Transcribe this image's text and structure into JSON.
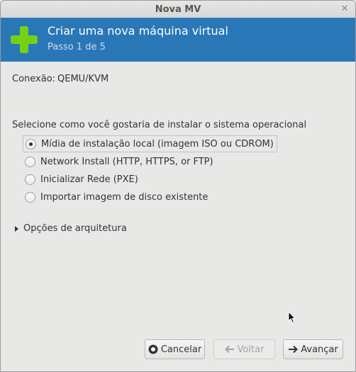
{
  "window": {
    "title": "Nova MV",
    "close_glyph": "✕"
  },
  "banner": {
    "icon": "plus-icon",
    "title": "Criar uma nova máquina virtual",
    "step": "Passo 1 de 5",
    "accent_color": "#2a77b7",
    "icon_color": "#73d216"
  },
  "connection": {
    "label": "Conexão:",
    "value": "QEMU/KVM"
  },
  "install": {
    "question": "Selecione como você gostaria de instalar o sistema operacional",
    "options": [
      {
        "label": "Mídia de instalação local (imagem ISO ou CDROM)",
        "selected": true
      },
      {
        "label": "Network Install (HTTP, HTTPS, or FTP)",
        "selected": false
      },
      {
        "label": "Inicializar Rede (PXE)",
        "selected": false
      },
      {
        "label": "Importar imagem de disco existente",
        "selected": false
      }
    ]
  },
  "architecture": {
    "label": "Opções de arquitetura",
    "expanded": false
  },
  "buttons": {
    "cancel": {
      "label": "Cancelar",
      "icon": "cancel-icon",
      "enabled": true
    },
    "back": {
      "label": "Voltar",
      "icon": "arrow-left-icon",
      "enabled": false
    },
    "forward": {
      "label": "Avançar",
      "icon": "arrow-right-icon",
      "enabled": true
    }
  }
}
